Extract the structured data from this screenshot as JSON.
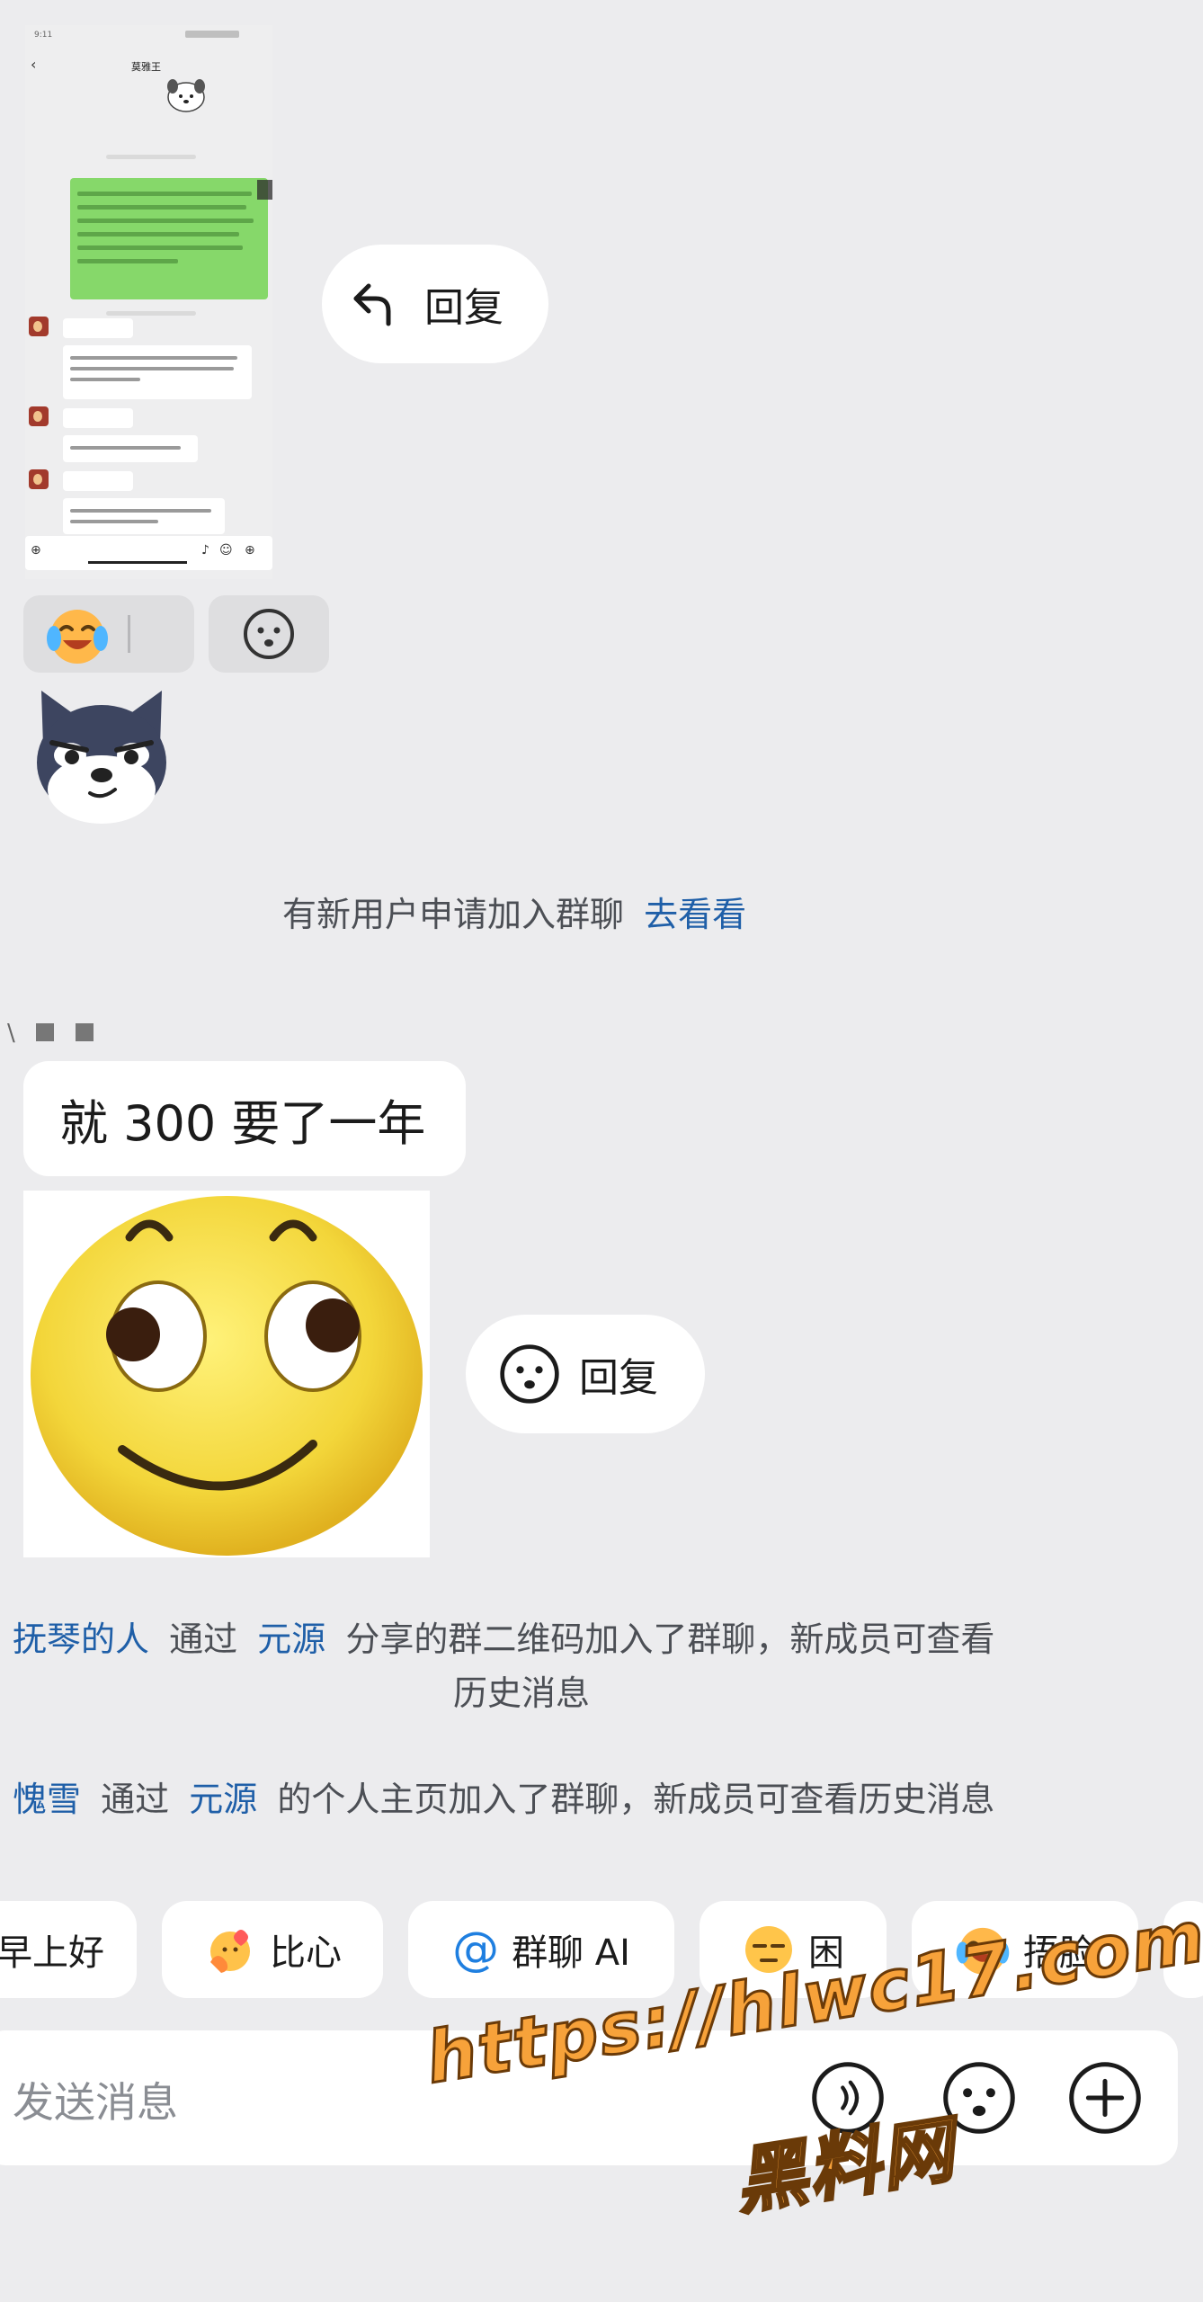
{
  "embedded_screenshot": {
    "status_time": "9:11",
    "title": "莫雅王",
    "back_label": "‹",
    "input_icons": [
      "add-circle-icon",
      "mic-icon",
      "emoji-icon",
      "plus-icon"
    ]
  },
  "reply_button_top": {
    "label": "回复",
    "icon": "reply-arrow-icon"
  },
  "emoji_picker": {
    "laugh_emoji": "laugh-cry-icon",
    "smiley_icon": "smiley-icon"
  },
  "system_notice": {
    "text": "有新用户申请加入群聊",
    "link": "去看看"
  },
  "message": {
    "sender_glyph": "\\",
    "text": "就 300 要了一年"
  },
  "reply_button_mid": {
    "label": "回复",
    "icon": "smiley-icon"
  },
  "join_events": [
    {
      "name": "抚琴的人",
      "pre": "通过",
      "via": "元源",
      "post": "分享的群二维码加入了群聊，新成员可查看",
      "post2": "历史消息"
    },
    {
      "name": "愧雪",
      "pre": "通过",
      "via": "元源",
      "post": "的个人主页加入了群聊，新成员可查看历史消息"
    }
  ],
  "quick_replies": [
    {
      "label": "早上好",
      "icon": ""
    },
    {
      "label": "比心",
      "icon": "heart-hands-icon"
    },
    {
      "label": "群聊 AI",
      "icon": "at-icon"
    },
    {
      "label": "困",
      "icon": "sleepy-face-icon"
    },
    {
      "label": "捂脸",
      "icon": "facepalm-icon"
    }
  ],
  "composer": {
    "placeholder": "发送消息",
    "icons": [
      "voice-icon",
      "emoji-icon",
      "plus-icon"
    ]
  },
  "watermark": {
    "line1": "https://hlwc17.com",
    "line2": "黑料网"
  },
  "colors": {
    "background": "#ececee",
    "link_blue": "#1f5fa8",
    "wechat_green": "#86d86a",
    "watermark_orange": "#f7a23a"
  }
}
